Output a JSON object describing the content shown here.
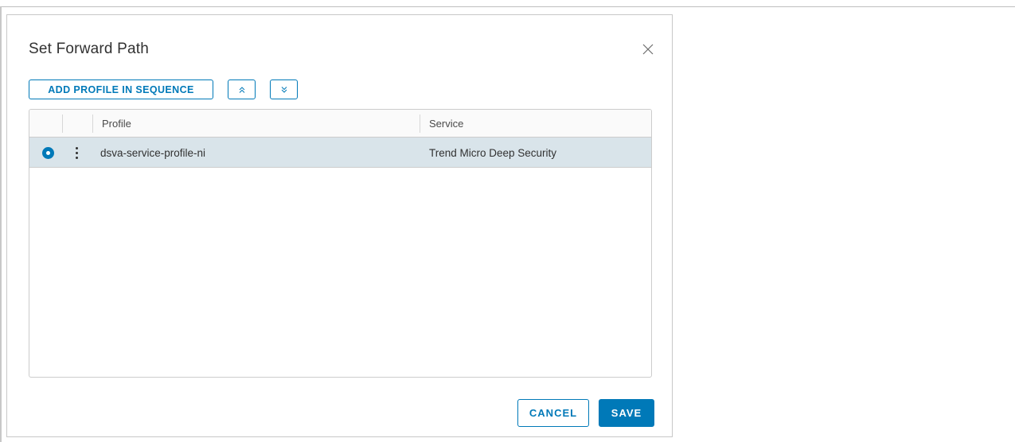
{
  "dialog": {
    "title": "Set Forward Path",
    "close_icon": "close-icon"
  },
  "toolbar": {
    "add_label": "ADD PROFILE IN SEQUENCE",
    "move_up_icon": "double-chevron-up-icon",
    "move_down_icon": "double-chevron-down-icon"
  },
  "grid": {
    "columns": [
      "Profile",
      "Service"
    ],
    "rows": [
      {
        "profile": "dsva-service-profile-ni",
        "service": "Trend Micro Deep Security",
        "selected": true
      }
    ]
  },
  "footer": {
    "cancel_label": "CANCEL",
    "save_label": "SAVE"
  },
  "colors": {
    "accent": "#0079b8",
    "selected_row": "#d9e4ea"
  }
}
